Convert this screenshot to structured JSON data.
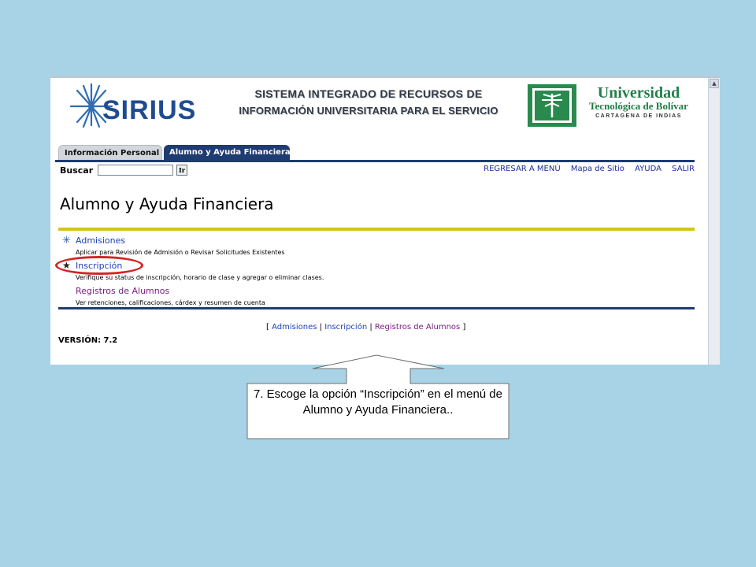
{
  "header": {
    "logo": "SIRIUS",
    "system_title_line1": "SISTEMA INTEGRADO DE RECURSOS DE",
    "system_title_line2": "INFORMACIÓN UNIVERSITARIA PARA EL SERVICIO",
    "university_line1": "Universidad",
    "university_line2": "Tecnológica de Bolívar",
    "university_line3": "CARTAGENA DE INDIAS",
    "brand_color": "#1f4c8f",
    "university_color": "#22804a"
  },
  "tabs": [
    {
      "label": "Información Personal",
      "active": false
    },
    {
      "label": "Alumno y Ayuda Financiera",
      "active": true
    }
  ],
  "search": {
    "label": "Buscar",
    "value": "",
    "go_label": "Ir"
  },
  "top_links": [
    "REGRESAR A MENÚ",
    "Mapa de Sitio",
    "AYUDA",
    "SALIR"
  ],
  "page_title": "Alumno y Ayuda Financiera",
  "menu": [
    {
      "label": "Admisiones",
      "description": "Aplicar para Revisión de Admisión o Revisar Solicitudes Existentes",
      "icon": "sparkle-icon"
    },
    {
      "label": "Inscripción",
      "description": "Verifique su status de inscripción, horario de clase y agregar o eliminar clases.",
      "icon": "star-icon",
      "highlighted": true
    },
    {
      "label": "Registros de Alumnos",
      "description": "Ver retenciones, calificaciones, cárdex y resumen de cuenta",
      "icon": ""
    }
  ],
  "bottom_links": {
    "open": "[",
    "items": [
      "Admisiones",
      "Inscripción",
      "Registros de Alumnos"
    ],
    "separator": "|",
    "close": "]"
  },
  "version": "VERSIÓN: 7.2",
  "callout": {
    "text": "7. Escoge la opción “Inscripción” en el menú de Alumno y Ayuda Financiera.."
  },
  "colors": {
    "background": "#a8d3e6",
    "navy": "#1f3c72",
    "gold": "#d3c419",
    "highlight": "#d62424"
  }
}
